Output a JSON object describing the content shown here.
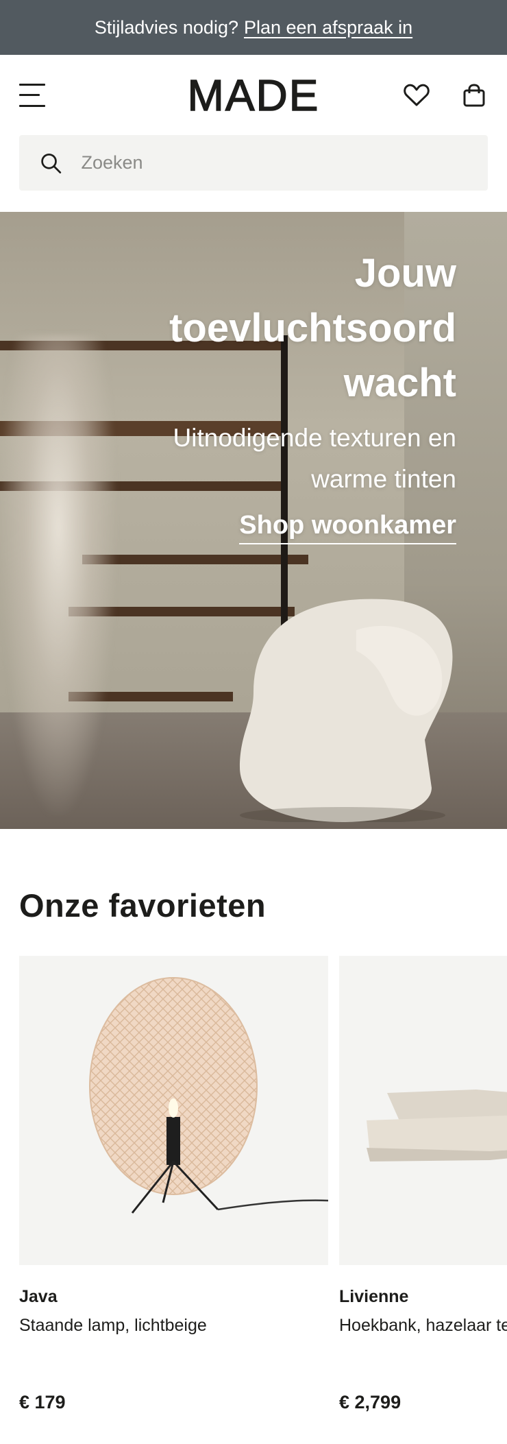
{
  "promo": {
    "text": "Stijladvies nodig?",
    "link": "Plan een afspraak in"
  },
  "header": {
    "logo": "MADE",
    "menu_icon": "menu-icon",
    "wishlist_icon": "heart-icon",
    "bag_icon": "shopping-bag-icon"
  },
  "search": {
    "placeholder": "Zoeken",
    "icon": "search-icon"
  },
  "hero": {
    "title": "Jouw toevluchtsoord wacht",
    "subtitle": "Uitnodigende texturen en warme tinten",
    "cta": "Shop woonkamer"
  },
  "favorites": {
    "heading": "Onze favorieten",
    "products": [
      {
        "name": "Java",
        "description": "Staande lamp, lichtbeige",
        "price": "€ 179"
      },
      {
        "name": "Livienne",
        "description": "Hoekbank, hazelaar textuurgewe",
        "price": "€ 2,799"
      }
    ]
  },
  "colors": {
    "promo_bg": "#525a60",
    "text": "#1d1d1b",
    "search_bg": "#f3f3f1",
    "card_bg": "#f4f4f2"
  }
}
